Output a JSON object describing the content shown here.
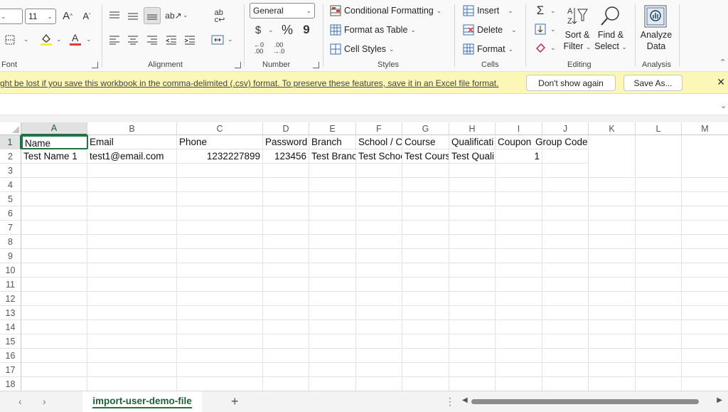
{
  "ribbon": {
    "font": {
      "size_value": "11",
      "group_label": "Font",
      "grow_label": "A^",
      "shrink_label": "Aˇ"
    },
    "alignment": {
      "group_label": "Alignment"
    },
    "number": {
      "format_value": "General",
      "currency_symbol": "$",
      "percent_symbol": "%",
      "comma_symbol": "9",
      "inc_decimal": "←0\n.00",
      "dec_decimal": ".00\n→.0",
      "group_label": "Number"
    },
    "styles": {
      "conditional_formatting": "Conditional Formatting",
      "format_as_table": "Format as Table",
      "cell_styles": "Cell Styles",
      "group_label": "Styles"
    },
    "cells": {
      "insert": "Insert",
      "delete": "Delete",
      "format": "Format",
      "group_label": "Cells"
    },
    "editing": {
      "sort_filter_1": "Sort &",
      "sort_filter_2": "Filter",
      "find_select_1": "Find &",
      "find_select_2": "Select",
      "group_label": "Editing"
    },
    "analysis": {
      "analyze_1": "Analyze",
      "analyze_2": "Data",
      "group_label": "Analysis"
    }
  },
  "message_bar": {
    "text": "ght be lost if you save this workbook in the comma-delimited (.csv) format. To preserve these features, save it in an Excel file format.",
    "dont_show_label": "Don't show again",
    "save_as_label": "Save As..."
  },
  "grid": {
    "columns": [
      "A",
      "B",
      "C",
      "D",
      "E",
      "F",
      "G",
      "H",
      "I",
      "J",
      "K",
      "L",
      "M"
    ],
    "rows": [
      "1",
      "2",
      "3",
      "4",
      "5",
      "6",
      "7",
      "8",
      "9",
      "10",
      "11",
      "12",
      "13",
      "14",
      "15",
      "16",
      "17",
      "18"
    ],
    "header_row": [
      "Name",
      "Email",
      "Phone",
      "Password",
      "Branch",
      "School / C",
      "Course",
      "Qualificati",
      "Coupon",
      "Group Code"
    ],
    "data_row": [
      "Test Name 1",
      "test1@email.com",
      "1232227899",
      "123456",
      "Test Branc",
      "Test Schoo",
      "Test Cours",
      "Test Quali",
      "1",
      ""
    ]
  },
  "sheet_tabs": {
    "active_tab": "import-user-demo-file",
    "add_label": "+"
  },
  "colors": {
    "accent": "#217346",
    "message_bar": "#fcf7b6"
  }
}
